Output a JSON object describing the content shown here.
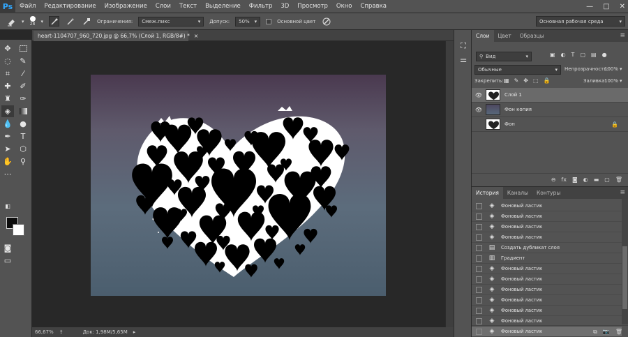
{
  "app": {
    "logo": "Ps"
  },
  "menu": [
    "Файл",
    "Редактирование",
    "Изображение",
    "Слои",
    "Текст",
    "Выделение",
    "Фильтр",
    "3D",
    "Просмотр",
    "Окно",
    "Справка"
  ],
  "window_controls": {
    "minimize": "—",
    "maximize": "□",
    "close": "✕"
  },
  "options": {
    "brush_size": "28",
    "limits_label": "Ограничения:",
    "limits_value": "Смеж.пикс",
    "tolerance_label": "Допуск:",
    "tolerance_value": "50%",
    "main_color_label": "Основной цвет",
    "workspace": "Основная рабочая среда"
  },
  "document": {
    "tab_title": "heart-1104707_960_720.jpg @ 66,7% (Слой 1, RGB/8#) *",
    "tab_close": "×",
    "zoom": "66,67%",
    "doc_info": "Док: 1,98M/5,65M"
  },
  "layers_panel": {
    "tabs": [
      "Слои",
      "Цвет",
      "Образцы"
    ],
    "kind_label": "Вид",
    "blend_mode": "Обычные",
    "opacity_label": "Непрозрачность:",
    "opacity_value": "100%",
    "lock_label": "Закрепить:",
    "fill_label": "Заливка:",
    "fill_value": "100%",
    "layers": [
      {
        "name": "Слой 1",
        "visible": true,
        "selected": true
      },
      {
        "name": "Фон копия",
        "visible": true,
        "selected": false
      },
      {
        "name": "Фон",
        "visible": false,
        "selected": false,
        "locked": true
      }
    ]
  },
  "history_panel": {
    "tabs": [
      "История",
      "Каналы",
      "Контуры"
    ],
    "items": [
      {
        "name": "Фоновый ластик",
        "icon": "eraser-icon"
      },
      {
        "name": "Фоновый ластик",
        "icon": "eraser-icon"
      },
      {
        "name": "Фоновый ластик",
        "icon": "eraser-icon"
      },
      {
        "name": "Фоновый ластик",
        "icon": "eraser-icon"
      },
      {
        "name": "Создать дубликат слоя",
        "icon": "layer-icon"
      },
      {
        "name": "Градиент",
        "icon": "gradient-icon"
      },
      {
        "name": "Фоновый ластик",
        "icon": "eraser-icon"
      },
      {
        "name": "Фоновый ластик",
        "icon": "eraser-icon"
      },
      {
        "name": "Фоновый ластик",
        "icon": "eraser-icon"
      },
      {
        "name": "Фоновый ластик",
        "icon": "eraser-icon"
      },
      {
        "name": "Фоновый ластик",
        "icon": "eraser-icon"
      },
      {
        "name": "Фоновый ластик",
        "icon": "eraser-icon"
      },
      {
        "name": "Фоновый ластик",
        "icon": "eraser-icon",
        "selected": true
      }
    ]
  },
  "colors": {
    "foreground": "#0c0c0c",
    "background": "#ffffff",
    "ps_blue": "#31a8ff"
  }
}
